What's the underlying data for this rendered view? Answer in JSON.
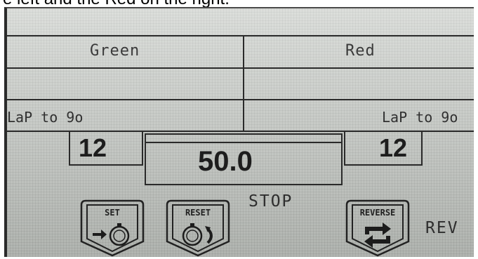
{
  "caption": "e left and the Red on the right.",
  "lanes": {
    "green": {
      "label": "Green",
      "lap_label": "LaP to 9o",
      "laps": "12"
    },
    "red": {
      "label": "Red",
      "lap_label": "LaP to 9o",
      "laps": "12"
    }
  },
  "timer": {
    "value": "50.0",
    "status": "STOP"
  },
  "buttons": {
    "set": {
      "label": "SET",
      "icon": "stopwatch-arrow-icon"
    },
    "reset": {
      "label": "RESET",
      "icon": "stopwatch-undo-icon"
    },
    "reverse": {
      "label": "REVERSE",
      "icon": "reverse-arrows-icon",
      "status": "REV"
    }
  }
}
